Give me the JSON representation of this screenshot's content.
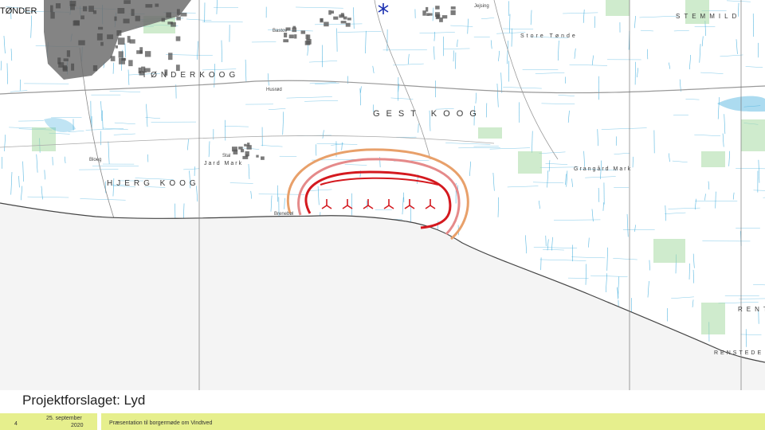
{
  "slide": {
    "title": "Projektforslaget: Lyd",
    "page_number": "4",
    "date_line1": "25. september",
    "date_line2": "2020",
    "footer_text": "Præsentation til borgermøde om Vindtved"
  },
  "map": {
    "colors": {
      "background": "#ffffff",
      "sea": "#f4f4f4",
      "coast": "#444444",
      "water_lines": "#2fa6d9",
      "field_green": "#a8dba4",
      "town": "#6f6f6f",
      "contour_outer": "#e8a06a",
      "contour_middle": "#e58a8a",
      "contour_inner": "#d4191f",
      "turbine": "#d4191f",
      "marker": "#1a2fb0"
    },
    "labels": {
      "town_main": "TØNDER",
      "koog_1": "TØNDERKOOG",
      "koog_2": "GEST KOOG",
      "koog_3": "HJERG KOOG",
      "place_jejsing": "Jejsing",
      "place_stemmild": "STEMMILD",
      "place_store_tonde": "Store Tønde",
      "place_grangard": "Grangård Mark",
      "place_jard_mark": "Jard Mark",
      "place_rent": "RENT",
      "place_renstede": "RENSTEDE",
      "place_small_1": "Stal",
      "place_small_2": "Bastov",
      "place_small_3": "Husrød",
      "place_small_4": "Brenebøl",
      "place_small_5": "Bloeg"
    },
    "turbine_icon": "wind-turbine-icon",
    "turbine_count": 6,
    "marker_icon": "asterisk-marker-icon"
  }
}
